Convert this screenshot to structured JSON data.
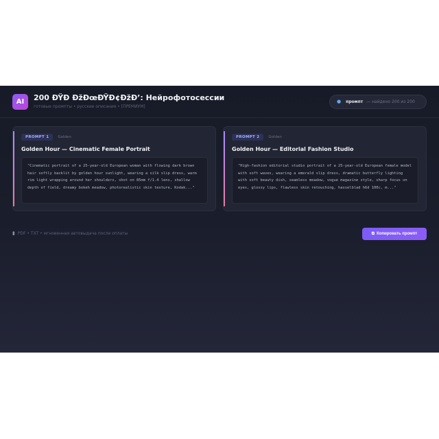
{
  "header": {
    "logo_text": "AI",
    "title": "200 ÐŸÐ ÐžÐœÐŸÐ¢ÐžÐ’: Нейрофотосессии",
    "subtitle": "готовые промпты • русские описания • [ПРЕМИУМ]"
  },
  "search": {
    "icon": "search-icon",
    "query": "промпт",
    "result": "— найдено 200 из 200"
  },
  "cards": [
    {
      "badge": "PROMPT 1",
      "tag": "Golden",
      "title": "Golden Hour — Cinematic Female Portrait",
      "prompt": "\"Cinematic portrait of a 25-year-old European woman with flowing dark brown hair softly backlit by golden hour sunlight, wearing a silk slip dress, warm rim light wrapping around her shoulders, shot on 85mm f/1.4 lens, shallow depth of field, dreamy bokeh meadow, photorealistic skin texture, Kodak...\""
    },
    {
      "badge": "PROMPT 2",
      "tag": "Golden",
      "title": "Golden Hour — Editorial Fashion Studio",
      "prompt": "\"High-fashion editorial studio portrait of a 25-year-old European female model with soft waves, wearing a emerald slip dress, dramatic butterfly lighting with soft beauty dish, seamless meadow, vogue magazine style, sharp focus on eyes, glossy lips, flawless skin retouching, hasselblad h6d 100c, m...\""
    }
  ],
  "footer": {
    "doc_icon": "document-icon",
    "note": "PDF • TXT • мгновенная автовыдача после оплаты",
    "copy_icon": "copy-icon",
    "copy_label": "Копировать промпт"
  },
  "colors": {
    "background": "#1a1d2b",
    "card": "#222533",
    "accent": "#8b5cf6",
    "badge_text": "#a5b4fc"
  }
}
